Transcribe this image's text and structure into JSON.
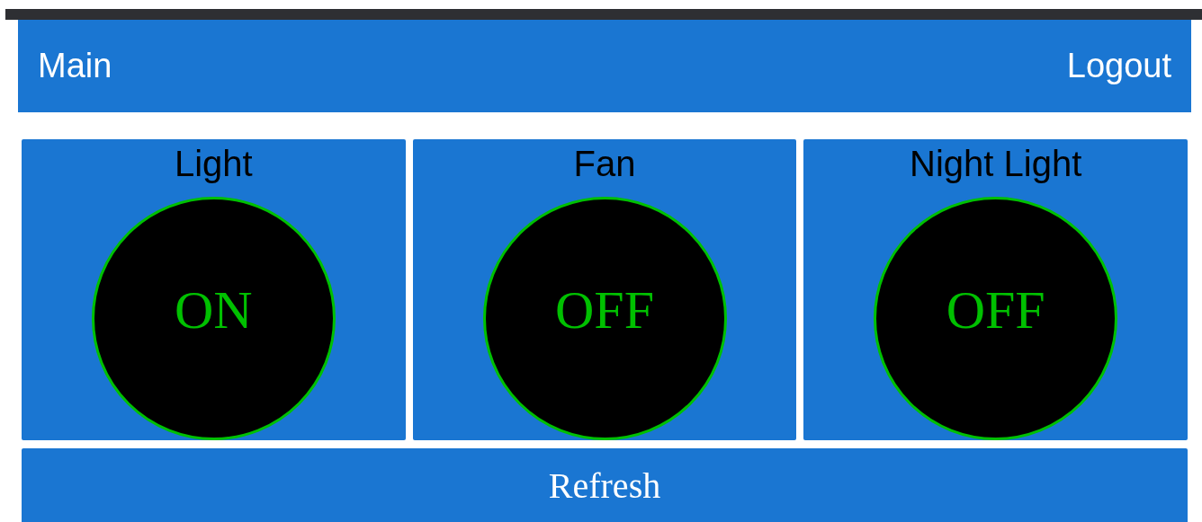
{
  "header": {
    "title": "Main",
    "logout": "Logout"
  },
  "devices": [
    {
      "label": "Light",
      "status": "ON"
    },
    {
      "label": "Fan",
      "status": "OFF"
    },
    {
      "label": "Night Light",
      "status": "OFF"
    }
  ],
  "refresh": "Refresh"
}
